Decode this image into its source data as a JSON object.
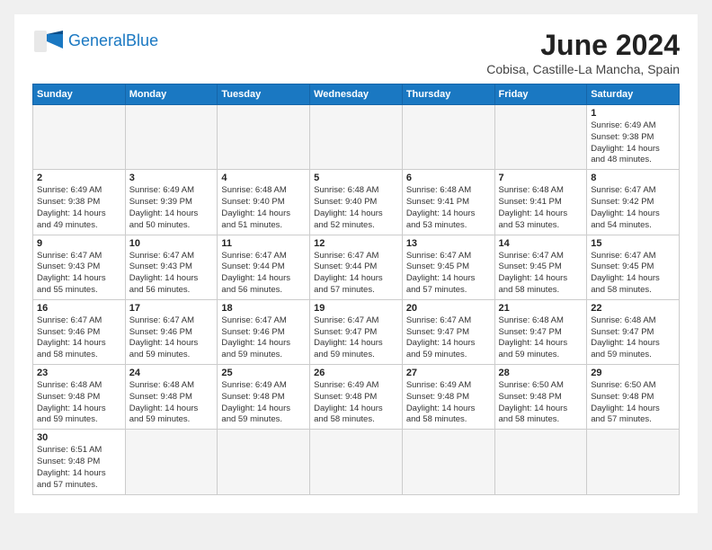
{
  "header": {
    "logo_general": "General",
    "logo_blue": "Blue",
    "month_title": "June 2024",
    "subtitle": "Cobisa, Castille-La Mancha, Spain"
  },
  "days_of_week": [
    "Sunday",
    "Monday",
    "Tuesday",
    "Wednesday",
    "Thursday",
    "Friday",
    "Saturday"
  ],
  "weeks": [
    [
      {
        "day": "",
        "info": ""
      },
      {
        "day": "",
        "info": ""
      },
      {
        "day": "",
        "info": ""
      },
      {
        "day": "",
        "info": ""
      },
      {
        "day": "",
        "info": ""
      },
      {
        "day": "",
        "info": ""
      },
      {
        "day": "1",
        "info": "Sunrise: 6:49 AM\nSunset: 9:38 PM\nDaylight: 14 hours\nand 48 minutes."
      }
    ],
    [
      {
        "day": "2",
        "info": "Sunrise: 6:49 AM\nSunset: 9:38 PM\nDaylight: 14 hours\nand 49 minutes."
      },
      {
        "day": "3",
        "info": "Sunrise: 6:49 AM\nSunset: 9:39 PM\nDaylight: 14 hours\nand 50 minutes."
      },
      {
        "day": "4",
        "info": "Sunrise: 6:48 AM\nSunset: 9:40 PM\nDaylight: 14 hours\nand 51 minutes."
      },
      {
        "day": "5",
        "info": "Sunrise: 6:48 AM\nSunset: 9:40 PM\nDaylight: 14 hours\nand 52 minutes."
      },
      {
        "day": "6",
        "info": "Sunrise: 6:48 AM\nSunset: 9:41 PM\nDaylight: 14 hours\nand 53 minutes."
      },
      {
        "day": "7",
        "info": "Sunrise: 6:48 AM\nSunset: 9:41 PM\nDaylight: 14 hours\nand 53 minutes."
      },
      {
        "day": "8",
        "info": "Sunrise: 6:47 AM\nSunset: 9:42 PM\nDaylight: 14 hours\nand 54 minutes."
      }
    ],
    [
      {
        "day": "9",
        "info": "Sunrise: 6:47 AM\nSunset: 9:43 PM\nDaylight: 14 hours\nand 55 minutes."
      },
      {
        "day": "10",
        "info": "Sunrise: 6:47 AM\nSunset: 9:43 PM\nDaylight: 14 hours\nand 56 minutes."
      },
      {
        "day": "11",
        "info": "Sunrise: 6:47 AM\nSunset: 9:44 PM\nDaylight: 14 hours\nand 56 minutes."
      },
      {
        "day": "12",
        "info": "Sunrise: 6:47 AM\nSunset: 9:44 PM\nDaylight: 14 hours\nand 57 minutes."
      },
      {
        "day": "13",
        "info": "Sunrise: 6:47 AM\nSunset: 9:45 PM\nDaylight: 14 hours\nand 57 minutes."
      },
      {
        "day": "14",
        "info": "Sunrise: 6:47 AM\nSunset: 9:45 PM\nDaylight: 14 hours\nand 58 minutes."
      },
      {
        "day": "15",
        "info": "Sunrise: 6:47 AM\nSunset: 9:45 PM\nDaylight: 14 hours\nand 58 minutes."
      }
    ],
    [
      {
        "day": "16",
        "info": "Sunrise: 6:47 AM\nSunset: 9:46 PM\nDaylight: 14 hours\nand 58 minutes."
      },
      {
        "day": "17",
        "info": "Sunrise: 6:47 AM\nSunset: 9:46 PM\nDaylight: 14 hours\nand 59 minutes."
      },
      {
        "day": "18",
        "info": "Sunrise: 6:47 AM\nSunset: 9:46 PM\nDaylight: 14 hours\nand 59 minutes."
      },
      {
        "day": "19",
        "info": "Sunrise: 6:47 AM\nSunset: 9:47 PM\nDaylight: 14 hours\nand 59 minutes."
      },
      {
        "day": "20",
        "info": "Sunrise: 6:47 AM\nSunset: 9:47 PM\nDaylight: 14 hours\nand 59 minutes."
      },
      {
        "day": "21",
        "info": "Sunrise: 6:48 AM\nSunset: 9:47 PM\nDaylight: 14 hours\nand 59 minutes."
      },
      {
        "day": "22",
        "info": "Sunrise: 6:48 AM\nSunset: 9:47 PM\nDaylight: 14 hours\nand 59 minutes."
      }
    ],
    [
      {
        "day": "23",
        "info": "Sunrise: 6:48 AM\nSunset: 9:48 PM\nDaylight: 14 hours\nand 59 minutes."
      },
      {
        "day": "24",
        "info": "Sunrise: 6:48 AM\nSunset: 9:48 PM\nDaylight: 14 hours\nand 59 minutes."
      },
      {
        "day": "25",
        "info": "Sunrise: 6:49 AM\nSunset: 9:48 PM\nDaylight: 14 hours\nand 59 minutes."
      },
      {
        "day": "26",
        "info": "Sunrise: 6:49 AM\nSunset: 9:48 PM\nDaylight: 14 hours\nand 58 minutes."
      },
      {
        "day": "27",
        "info": "Sunrise: 6:49 AM\nSunset: 9:48 PM\nDaylight: 14 hours\nand 58 minutes."
      },
      {
        "day": "28",
        "info": "Sunrise: 6:50 AM\nSunset: 9:48 PM\nDaylight: 14 hours\nand 58 minutes."
      },
      {
        "day": "29",
        "info": "Sunrise: 6:50 AM\nSunset: 9:48 PM\nDaylight: 14 hours\nand 57 minutes."
      }
    ],
    [
      {
        "day": "30",
        "info": "Sunrise: 6:51 AM\nSunset: 9:48 PM\nDaylight: 14 hours\nand 57 minutes."
      },
      {
        "day": "",
        "info": ""
      },
      {
        "day": "",
        "info": ""
      },
      {
        "day": "",
        "info": ""
      },
      {
        "day": "",
        "info": ""
      },
      {
        "day": "",
        "info": ""
      },
      {
        "day": "",
        "info": ""
      }
    ]
  ]
}
